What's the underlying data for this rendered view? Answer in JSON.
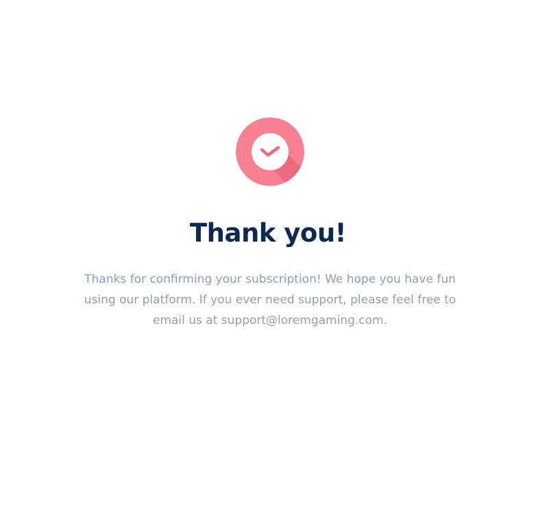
{
  "confirmation": {
    "title": "Thank you!",
    "message": "Thanks for confirming your subscription! We hope you have fun using our platform. If you ever need support, please feel free to email us at support@loremgaming.com.",
    "icon": "check-circle-icon"
  },
  "colors": {
    "badge": "#f98090",
    "badge_shadow": "#ec6a7d",
    "check": "#ec6a7d",
    "title": "#0d2851",
    "message": "#969aab",
    "background": "#ffffff"
  }
}
